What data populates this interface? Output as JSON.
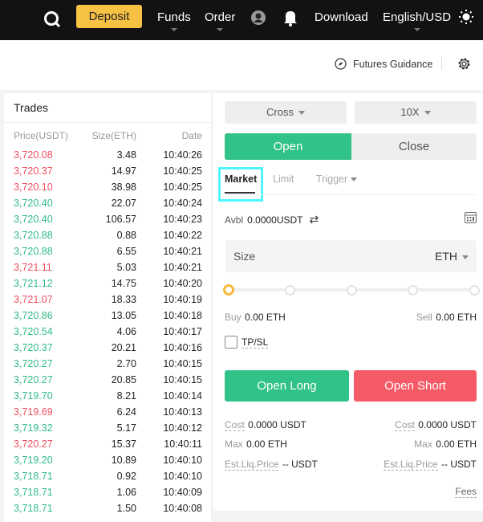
{
  "topbar": {
    "deposit": "Deposit",
    "funds": "Funds",
    "order": "Order",
    "download": "Download",
    "language": "English/USD",
    "icons": [
      "search-icon",
      "user-icon",
      "bell-icon",
      "sun-icon"
    ]
  },
  "subheader": {
    "futures_guidance": "Futures Guidance"
  },
  "trades": {
    "title": "Trades",
    "columns": [
      "Price(USDT)",
      "Size(ETH)",
      "Date"
    ],
    "rows": [
      [
        "3,720.08",
        "3.48",
        "10:40:26",
        "sell"
      ],
      [
        "3,720.37",
        "14.97",
        "10:40:25",
        "sell"
      ],
      [
        "3,720.10",
        "38.98",
        "10:40:25",
        "sell"
      ],
      [
        "3,720.40",
        "22.07",
        "10:40:24",
        "buy"
      ],
      [
        "3,720.40",
        "106.57",
        "10:40:23",
        "buy"
      ],
      [
        "3,720.88",
        "0.88",
        "10:40:22",
        "buy"
      ],
      [
        "3,720.88",
        "6.55",
        "10:40:21",
        "buy"
      ],
      [
        "3,721.11",
        "5.03",
        "10:40:21",
        "sell"
      ],
      [
        "3,721.12",
        "14.75",
        "10:40:20",
        "buy"
      ],
      [
        "3,721.07",
        "18.33",
        "10:40:19",
        "sell"
      ],
      [
        "3,720.86",
        "13.05",
        "10:40:18",
        "buy"
      ],
      [
        "3,720.54",
        "4.06",
        "10:40:17",
        "buy"
      ],
      [
        "3,720.37",
        "20.21",
        "10:40:16",
        "buy"
      ],
      [
        "3,720.27",
        "2.70",
        "10:40:15",
        "buy"
      ],
      [
        "3,720.27",
        "20.85",
        "10:40:15",
        "buy"
      ],
      [
        "3,719.70",
        "8.21",
        "10:40:14",
        "buy"
      ],
      [
        "3,719.69",
        "6.24",
        "10:40:13",
        "sell"
      ],
      [
        "3,719.32",
        "5.17",
        "10:40:12",
        "buy"
      ],
      [
        "3,720.27",
        "15.37",
        "10:40:11",
        "sell"
      ],
      [
        "3,719.20",
        "10.89",
        "10:40:10",
        "buy"
      ],
      [
        "3,718.71",
        "0.92",
        "10:40:10",
        "buy"
      ],
      [
        "3,718.71",
        "1.06",
        "10:40:09",
        "buy"
      ],
      [
        "3,718.71",
        "1.50",
        "10:40:08",
        "buy"
      ]
    ]
  },
  "order": {
    "margin_mode": "Cross",
    "leverage": "10X",
    "open": "Open",
    "close": "Close",
    "tabs": [
      "Market",
      "Limit",
      "Trigger"
    ],
    "active_tab": "Market",
    "avbl_label": "Avbl",
    "avbl_value": "0.0000USDT",
    "size_placeholder": "Size",
    "size_unit": "ETH",
    "slider_percent": 0,
    "buy_label": "Buy",
    "buy_value": "0.00 ETH",
    "sell_label": "Sell",
    "sell_value": "0.00 ETH",
    "tpsl": "TP/SL",
    "tpsl_checked": false,
    "open_long": "Open Long",
    "open_short": "Open Short",
    "cost_label": "Cost",
    "cost_value": "0.0000 USDT",
    "max_label": "Max",
    "max_value": "0.00 ETH",
    "liq_label": "Est.Liq.Price",
    "liq_value": "-- USDT",
    "fees": "Fees"
  },
  "colors": {
    "buy": "#2fbd85",
    "sell": "#f24e5e",
    "deposit": "#f7c244",
    "highlight": "#4ef6fb"
  }
}
